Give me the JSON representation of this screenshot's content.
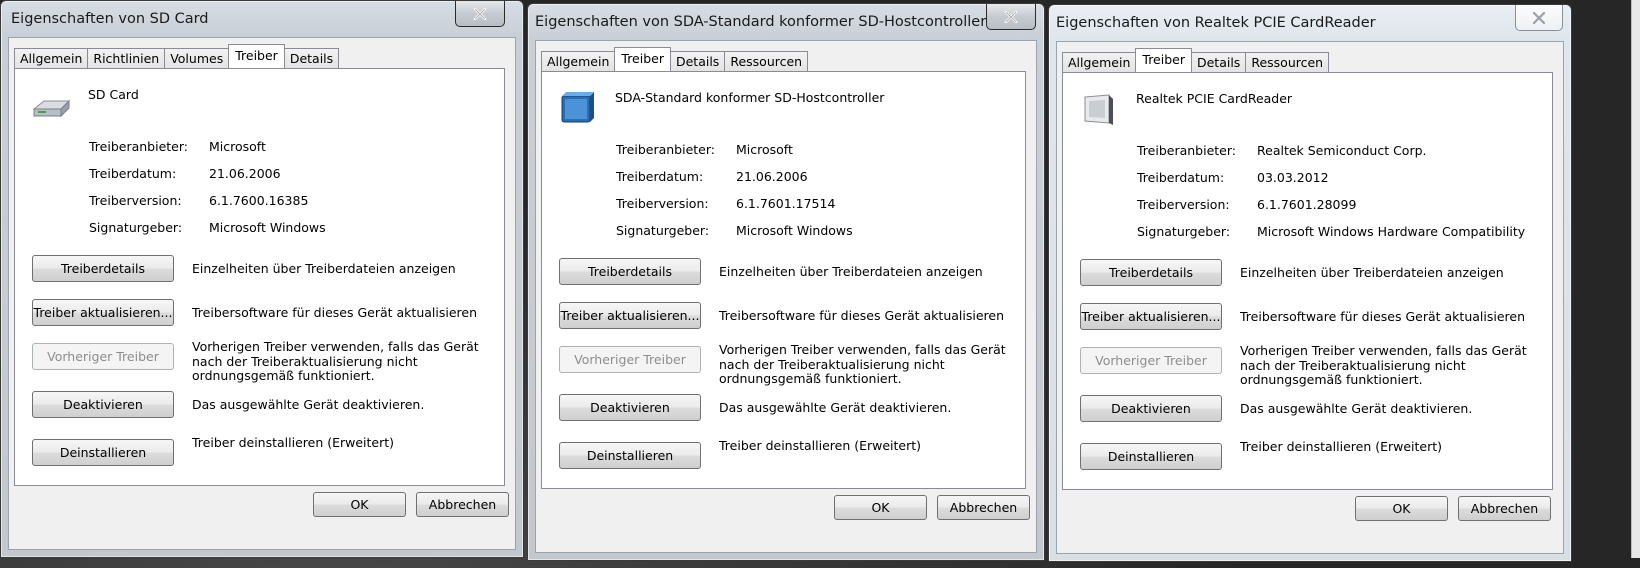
{
  "windows": [
    {
      "title": "Eigenschaften von SD Card",
      "tabs": [
        "Allgemein",
        "Richtlinien",
        "Volumes",
        "Treiber",
        "Details"
      ],
      "selected_tab": "Treiber",
      "device_name": "SD Card",
      "device_icon": "sd-card-drive-icon",
      "info": [
        {
          "label": "Treiberanbieter:",
          "value": "Microsoft"
        },
        {
          "label": "Treiberdatum:",
          "value": "21.06.2006"
        },
        {
          "label": "Treiberversion:",
          "value": "6.1.7600.16385"
        },
        {
          "label": "Signaturgeber:",
          "value": "Microsoft Windows"
        }
      ],
      "actions": [
        {
          "button": "Treiberdetails",
          "desc": "Einzelheiten über Treiberdateien anzeigen",
          "enabled": true
        },
        {
          "button": "Treiber aktualisieren...",
          "desc": "Treibersoftware für dieses Gerät aktualisieren",
          "enabled": true
        },
        {
          "button": "Vorheriger Treiber",
          "desc": "Vorherigen Treiber verwenden, falls das Gerät nach der Treiberaktualisierung nicht ordnungsgemäß funktioniert.",
          "enabled": false
        },
        {
          "button": "Deaktivieren",
          "desc": "Das ausgewählte Gerät deaktivieren.",
          "enabled": true
        },
        {
          "button": "Deinstallieren",
          "desc": "Treiber deinstallieren (Erweitert)",
          "enabled": true
        }
      ],
      "ok": "OK",
      "cancel": "Abbrechen"
    },
    {
      "title": "Eigenschaften von SDA-Standard konformer SD-Hostcontroller",
      "tabs": [
        "Allgemein",
        "Treiber",
        "Details",
        "Ressourcen"
      ],
      "selected_tab": "Treiber",
      "device_name": "SDA-Standard konformer SD-Hostcontroller",
      "device_icon": "host-controller-icon",
      "info": [
        {
          "label": "Treiberanbieter:",
          "value": "Microsoft"
        },
        {
          "label": "Treiberdatum:",
          "value": "21.06.2006"
        },
        {
          "label": "Treiberversion:",
          "value": "6.1.7601.17514"
        },
        {
          "label": "Signaturgeber:",
          "value": "Microsoft Windows"
        }
      ],
      "actions": [
        {
          "button": "Treiberdetails",
          "desc": "Einzelheiten über Treiberdateien anzeigen",
          "enabled": true
        },
        {
          "button": "Treiber aktualisieren...",
          "desc": "Treibersoftware für dieses Gerät aktualisieren",
          "enabled": true
        },
        {
          "button": "Vorheriger Treiber",
          "desc": "Vorherigen Treiber verwenden, falls das Gerät nach der Treiberaktualisierung nicht ordnungsgemäß funktioniert.",
          "enabled": false
        },
        {
          "button": "Deaktivieren",
          "desc": "Das ausgewählte Gerät deaktivieren.",
          "enabled": true
        },
        {
          "button": "Deinstallieren",
          "desc": "Treiber deinstallieren (Erweitert)",
          "enabled": true
        }
      ],
      "ok": "OK",
      "cancel": "Abbrechen"
    },
    {
      "title": "Eigenschaften von Realtek PCIE CardReader",
      "tabs": [
        "Allgemein",
        "Treiber",
        "Details",
        "Ressourcen"
      ],
      "selected_tab": "Treiber",
      "device_name": "Realtek PCIE CardReader",
      "device_icon": "card-reader-icon",
      "info": [
        {
          "label": "Treiberanbieter:",
          "value": "Realtek Semiconduct Corp."
        },
        {
          "label": "Treiberdatum:",
          "value": "03.03.2012"
        },
        {
          "label": "Treiberversion:",
          "value": "6.1.7601.28099"
        },
        {
          "label": "Signaturgeber:",
          "value": "Microsoft Windows Hardware Compatibility"
        }
      ],
      "actions": [
        {
          "button": "Treiberdetails",
          "desc": "Einzelheiten über Treiberdateien anzeigen",
          "enabled": true
        },
        {
          "button": "Treiber aktualisieren...",
          "desc": "Treibersoftware für dieses Gerät aktualisieren",
          "enabled": true
        },
        {
          "button": "Vorheriger Treiber",
          "desc": "Vorherigen Treiber verwenden, falls das Gerät nach der Treiberaktualisierung nicht ordnungsgemäß funktioniert.",
          "enabled": false
        },
        {
          "button": "Deaktivieren",
          "desc": "Das ausgewählte Gerät deaktivieren.",
          "enabled": true
        },
        {
          "button": "Deinstallieren",
          "desc": "Treiber deinstallieren (Erweitert)",
          "enabled": true
        }
      ],
      "ok": "OK",
      "cancel": "Abbrechen"
    }
  ]
}
